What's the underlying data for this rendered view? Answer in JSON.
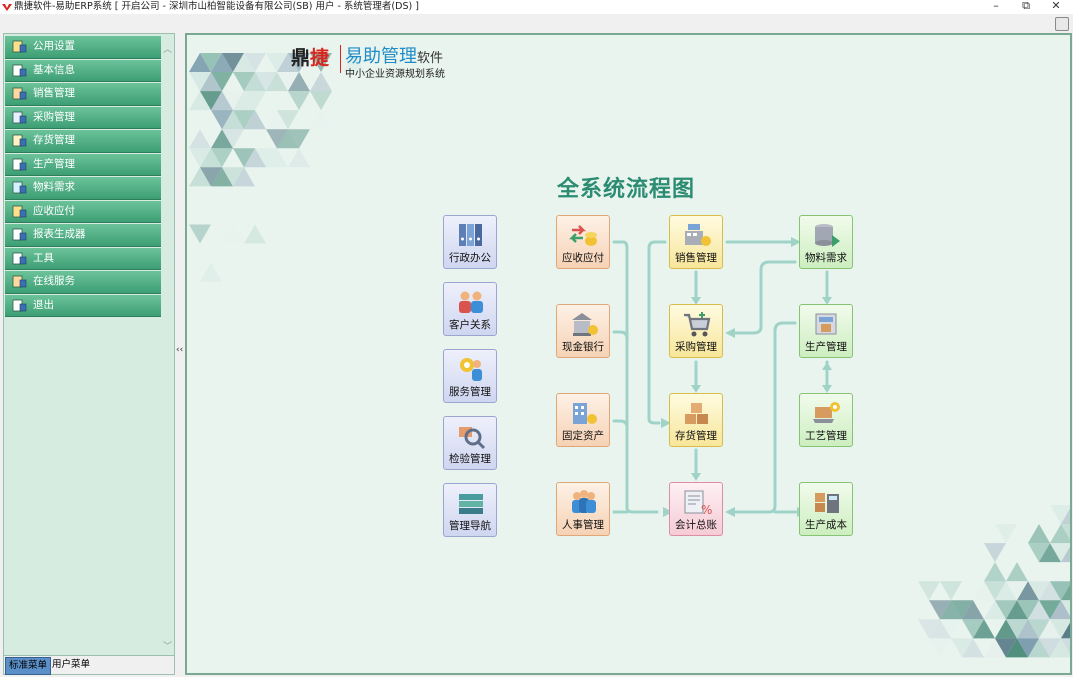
{
  "titlebar": {
    "title": "鼎捷软件-易助ERP系统  [ 开启公司 - 深圳市山柏智能设备有限公司(SB)    用户 - 系统管理者(DS) ]",
    "minimize": "–",
    "restore": "⧉",
    "close": "✕"
  },
  "sidebar": {
    "items": [
      {
        "label": "公用设置",
        "icon": "settings-icon"
      },
      {
        "label": "基本信息",
        "icon": "info-icon"
      },
      {
        "label": "销售管理",
        "icon": "sales-icon"
      },
      {
        "label": "采购管理",
        "icon": "purchase-icon"
      },
      {
        "label": "存货管理",
        "icon": "inventory-icon"
      },
      {
        "label": "生产管理",
        "icon": "production-icon"
      },
      {
        "label": "物料需求",
        "icon": "material-icon"
      },
      {
        "label": "应收应付",
        "icon": "receivable-icon"
      },
      {
        "label": "报表生成器",
        "icon": "report-icon"
      },
      {
        "label": "工具",
        "icon": "tools-icon"
      },
      {
        "label": "在线服务",
        "icon": "online-icon"
      },
      {
        "label": "退出",
        "icon": "exit-icon"
      }
    ],
    "tabs": [
      "标准菜单",
      "用户菜单"
    ]
  },
  "splitter": {
    "glyph": "‹‹"
  },
  "main": {
    "brand_main": "鼎",
    "brand_red": "捷",
    "brand_name": "易助管理",
    "brand_suffix": "软件",
    "brand_sub": "中小企业资源规划系统",
    "flow_title": "全系统流程图",
    "nodes": {
      "admin": "行政办公",
      "crm": "客户关系",
      "service": "服务管理",
      "inspection": "检验管理",
      "navigation": "管理导航",
      "ar_ap": "应收应付",
      "cash_bank": "现金银行",
      "fixed_assets": "固定资产",
      "hr": "人事管理",
      "sales": "销售管理",
      "purchase": "采购管理",
      "inventory": "存货管理",
      "ledger": "会计总账",
      "mrp": "物料需求",
      "production": "生产管理",
      "process": "工艺管理",
      "cost": "生产成本"
    }
  },
  "colors": {
    "menu_green": "#4caf84",
    "flow_title": "#2c8c72",
    "arrow": "#9fd3c8",
    "brand_red": "#d9241c",
    "brand_blue": "#1f8cc8"
  }
}
